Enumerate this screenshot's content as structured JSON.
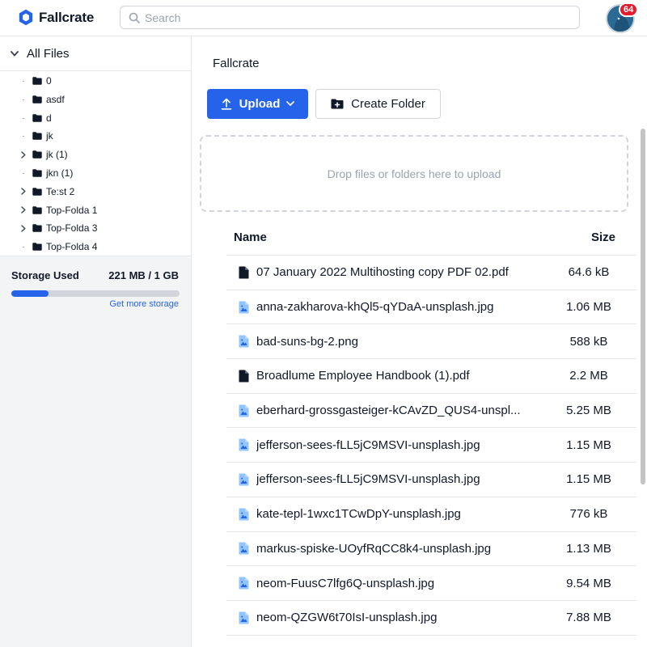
{
  "app": {
    "name": "Fallcrate",
    "brand_color": "#2563eb"
  },
  "header": {
    "search_placeholder": "Search",
    "notification_count": "64"
  },
  "sidebar": {
    "root_label": "All Files",
    "tree": [
      {
        "label": "0",
        "expandable": false
      },
      {
        "label": "asdf",
        "expandable": false
      },
      {
        "label": "d",
        "expandable": false
      },
      {
        "label": "jk",
        "expandable": false
      },
      {
        "label": "jk (1)",
        "expandable": true
      },
      {
        "label": "jkn (1)",
        "expandable": false
      },
      {
        "label": "Te:st 2",
        "expandable": true
      },
      {
        "label": "Top-Folda 1",
        "expandable": true
      },
      {
        "label": "Top-Folda 3",
        "expandable": true
      },
      {
        "label": "Top-Folda 4",
        "expandable": false
      }
    ],
    "storage": {
      "title": "Storage Used",
      "value": "221 MB / 1 GB",
      "fraction_used": 0.221,
      "link": "Get more storage"
    }
  },
  "main": {
    "breadcrumb": "Fallcrate",
    "upload_label": "Upload",
    "create_folder_label": "Create Folder",
    "dropzone_text": "Drop files or folders here to upload",
    "columns": {
      "name": "Name",
      "size": "Size"
    },
    "files": [
      {
        "name": "07 January 2022 Multihosting copy PDF 02.pdf",
        "size": "64.6 kB",
        "icon": "pdf-file-icon"
      },
      {
        "name": "anna-zakharova-khQl5-qYDaA-unsplash.jpg",
        "size": "1.06 MB",
        "icon": "image-file-icon"
      },
      {
        "name": "bad-suns-bg-2.png",
        "size": "588 kB",
        "icon": "image-file-icon"
      },
      {
        "name": "Broadlume Employee Handbook (1).pdf",
        "size": "2.2 MB",
        "icon": "pdf-file-icon"
      },
      {
        "name": "eberhard-grossgasteiger-kCAvZD_QUS4-unspl...",
        "size": "5.25 MB",
        "icon": "image-file-icon"
      },
      {
        "name": "jefferson-sees-fLL5jC9MSVI-unsplash.jpg",
        "size": "1.15 MB",
        "icon": "image-file-icon"
      },
      {
        "name": "jefferson-sees-fLL5jC9MSVI-unsplash.jpg",
        "size": "1.15 MB",
        "icon": "image-file-icon"
      },
      {
        "name": "kate-tepl-1wxc1TCwDpY-unsplash.jpg",
        "size": "776 kB",
        "icon": "image-file-icon"
      },
      {
        "name": "markus-spiske-UOyfRqCC8k4-unsplash.jpg",
        "size": "1.13 MB",
        "icon": "image-file-icon"
      },
      {
        "name": "neom-FuusC7lfg6Q-unsplash.jpg",
        "size": "9.54 MB",
        "icon": "image-file-icon"
      },
      {
        "name": "neom-QZGW6t70IsI-unsplash.jpg",
        "size": "7.88 MB",
        "icon": "image-file-icon"
      }
    ]
  }
}
